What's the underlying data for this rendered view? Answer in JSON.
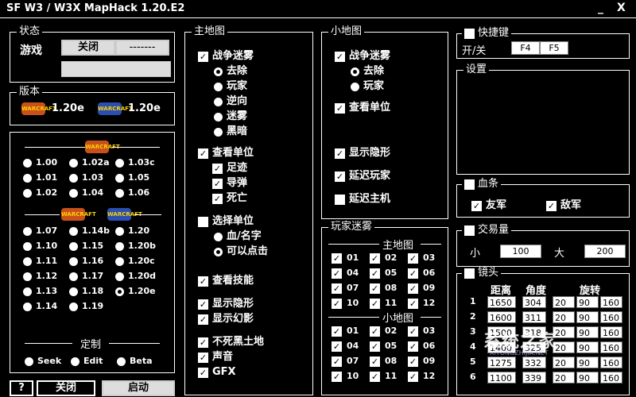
{
  "title": "SF    W3 / W3X MapHack 1.20.E2",
  "window_buttons": {
    "minimize": "_",
    "close": "X"
  },
  "status": {
    "legend": "状态",
    "game_label": "游戏",
    "close_btn": "关闭",
    "dash_btn": "-------"
  },
  "version": {
    "legend": "版本",
    "roc": "1.20e",
    "tft": "1.20e",
    "roc_logo": "WARCRAFT",
    "tft_logo": "WARCRAFT"
  },
  "versions_roc": [
    "1.00",
    "1.02a",
    "1.03c",
    "1.01",
    "1.03",
    "1.05",
    "1.02",
    "1.04",
    "1.06"
  ],
  "versions_tft": [
    "1.07",
    "1.14b",
    "1.20",
    "1.10",
    "1.15",
    "1.20b",
    "1.11",
    "1.16",
    "1.20c",
    "1.12",
    "1.17",
    "1.20d",
    "1.13",
    "1.18",
    "1.20e",
    "1.14",
    "1.19"
  ],
  "custom": {
    "legend": "定制",
    "seek": "Seek",
    "edit": "Edit",
    "beta": "Beta"
  },
  "bottom": {
    "help": "?",
    "close": "关闭",
    "start": "启动"
  },
  "main_map": {
    "legend": "主地图",
    "fog": "战争迷雾",
    "fog_opts": [
      "去除",
      "玩家",
      "逆向",
      "迷雾",
      "黑暗"
    ],
    "view_units": "查看单位",
    "unit_opts": [
      "足迹",
      "导弹",
      "死亡"
    ],
    "select_units": "选择单位",
    "select_opts": [
      "血/名字",
      "可以点击"
    ],
    "view_skills": "查看技能",
    "show_invisible": "显示隐形",
    "show_illusion": "显示幻影",
    "undead_ground": "不死黑土地",
    "sound": "声音",
    "gfx": "GFX"
  },
  "mini_map": {
    "legend": "小地图",
    "fog": "战争迷雾",
    "fog_opts": [
      "去除",
      "玩家"
    ],
    "view_units": "查看单位",
    "show_invisible": "显示隐形",
    "delay_player": "延迟玩家",
    "delay_host": "延迟主机"
  },
  "player_fog": {
    "legend": "玩家迷雾",
    "main_label": "主地图",
    "mini_label": "小地图",
    "numbers": [
      "01",
      "02",
      "03",
      "04",
      "05",
      "06",
      "07",
      "08",
      "09",
      "10",
      "11",
      "12"
    ]
  },
  "hotkey": {
    "legend": "快捷键",
    "toggle": "开/关",
    "k1": "F4",
    "k2": "F5"
  },
  "settings": {
    "legend": "设置"
  },
  "hp_bar": {
    "legend": "血条",
    "ally": "友军",
    "enemy": "敌军"
  },
  "trade": {
    "legend": "交易量",
    "small": "小",
    "small_val": "100",
    "big": "大",
    "big_val": "200"
  },
  "camera": {
    "legend": "镜头",
    "headers": [
      "距离",
      "角度",
      "旋转"
    ],
    "rows": [
      {
        "n": "1",
        "d": "1650",
        "a": "304",
        "r": [
          "20",
          "90",
          "160"
        ]
      },
      {
        "n": "2",
        "d": "1600",
        "a": "311",
        "r": [
          "20",
          "90",
          "160"
        ]
      },
      {
        "n": "3",
        "d": "1500",
        "a": "318",
        "r": [
          "20",
          "90",
          "160"
        ]
      },
      {
        "n": "4",
        "d": "1400",
        "a": "325",
        "r": [
          "20",
          "90",
          "160"
        ]
      },
      {
        "n": "5",
        "d": "1275",
        "a": "332",
        "r": [
          "20",
          "90",
          "160"
        ]
      },
      {
        "n": "6",
        "d": "1100",
        "a": "339",
        "r": [
          "20",
          "90",
          "160"
        ]
      }
    ]
  },
  "watermark": {
    "text": "系统之家",
    "url": "XITONGZHIJIA.NET"
  }
}
